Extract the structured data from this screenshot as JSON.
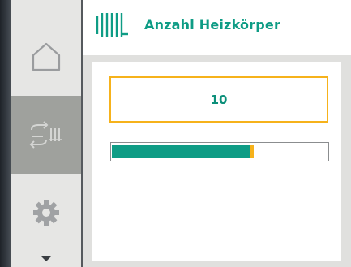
{
  "header": {
    "title": "Anzahl Heizkörper",
    "icon": "radiator-icon"
  },
  "sidebar": {
    "items": [
      {
        "name": "home",
        "icon": "home-icon",
        "selected": false
      },
      {
        "name": "operating-mode",
        "icon": "mode-cycle-icon",
        "selected": true
      },
      {
        "name": "settings",
        "icon": "gear-icon",
        "selected": false
      }
    ],
    "scroll_icon": "triangle-down-icon"
  },
  "editor": {
    "value": "10",
    "progress_fraction": 0.64
  },
  "colors": {
    "accent_green": "#0e9c85",
    "focus_orange": "#f6b21b",
    "sidebar_bg": "#e6e6e4",
    "sidebar_selected": "#9fa19d"
  }
}
